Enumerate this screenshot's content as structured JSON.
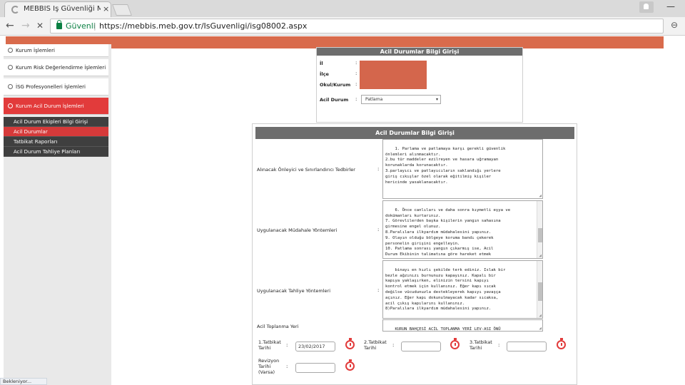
{
  "browser": {
    "tab_title": "MEBBIS İş Güvenliği Mo",
    "tab_close": "×",
    "secure_label": "Güvenli",
    "separator": "|",
    "url": "https://mebbis.meb.gov.tr/IsGuvenligi/isg08002.aspx",
    "back": "←",
    "forward": "→",
    "stop": "✕",
    "zoom_icon": "⊖",
    "minimize": "—"
  },
  "sidebar": {
    "items": [
      {
        "label": "Kurum İşlemleri"
      },
      {
        "label": "Kurum Risk Değerlendirme İşlemleri"
      },
      {
        "label": "İSG Profesyonelleri İşlemleri"
      },
      {
        "label": "Kurum Acil Durum İşlemleri"
      }
    ],
    "sub_items": [
      {
        "label": "Acil Durum Ekipleri Bilgi Girişi"
      },
      {
        "label": "Acil Durumlar"
      },
      {
        "label": "Tatbikat Raporları"
      },
      {
        "label": "Acil Durum Tahliye Planları"
      }
    ]
  },
  "info_panel": {
    "title": "Acil Durumlar Bilgi Girişi",
    "fields": [
      {
        "label": "İl",
        "colon": ":"
      },
      {
        "label": "İlçe",
        "colon": ":"
      },
      {
        "label": "Okul/Kurum",
        "colon": ":"
      },
      {
        "label": "Acil Durum",
        "colon": ":"
      }
    ],
    "acil_durum_value": "Patlama",
    "caret": "▾"
  },
  "form": {
    "title": "Acil Durumlar Bilgi Girişi",
    "colon": ":",
    "alinacak_label": "Alınacak Önleyici ve Sınırlandırıcı Tedbirler",
    "alinacak_text": "1. Parlama ve patlamaya karşı gerekli güvenlik\nönlemleri alınmacaktır.\n2.bu tür maddeler ezilreyen ve hasara uğramayan\nkorunaklarda korunacaktır.\n3.parlayıcı ve patlayıcıların saklandığı yerlere\ngiriş cıkışlar özel olarak eğitilmiş kişiler\nhericinde yasaklanacaktır.",
    "mudahale_label": "Uygulanacak Müdahale Yöntemleri",
    "mudahale_text": "6. Önce canlıları ve daha sonra kıymetli eşya ve\ndokümanları kurtarınız.\n7. Görevlilerden başka kişilerin yangın sahasına\ngirmesine engel olunuz.\n8.Paralılara ilkyardım müdahalesini yapınız.\n9. Olayın olduğu bölgeye koruma bandı çekerek\npersonelin girişini engelleyin.\n10. Patlama sonrası yangın çıkarmış ise, Acil\nDurum Ekibinin talimatına göre hareket etmek",
    "tahliye_label": "Uygulanacak Tahliye Yöntemleri",
    "tahliye_text": "binayı en hızlı şekilde terk ediniz. Islak bir\nbezle ağzınızı burnunuzu kapayınız. Kapalı bir\nkapıya yaklaşırken, elinizin tersini kapıyı\nkontrol etmek için kullanınız. Eğer kapı sıcak\ndeğilse vücudunuzla destekleyerek kapıyı yavaşça\naçınız. Eğer kapı dokunulmayacak kadar sıcaksa,\nacil çıkış kapılarını kullanınız.\n8)Paralılara ilkyardım müdahalesini yapınız.",
    "toplanma_label": "Acil Toplanma Yeri",
    "toplanma_value": "KURUN BAHÇESİ ACİL TOPLANMA YERİ LEV-ASI ÖNÜ",
    "tatbikat1_label": "1.Tatbikat Tarihi",
    "tatbikat1_value": "23/02/2017",
    "tatbikat2_label": "2.Tatbikat Tarihi",
    "tatbikat2_value": "",
    "tatbikat3_label": "3.Tatbikat Tarihi",
    "tatbikat3_value": "",
    "revizyon_label": "Revizyon Tarihi (Varsa)",
    "revizyon_value": ""
  },
  "status": {
    "text": "Bekleniyor..."
  },
  "colors": {
    "brand_band": "#d96b4c",
    "active_menu": "#e23b3b",
    "panel_header": "#6d6d6d"
  }
}
